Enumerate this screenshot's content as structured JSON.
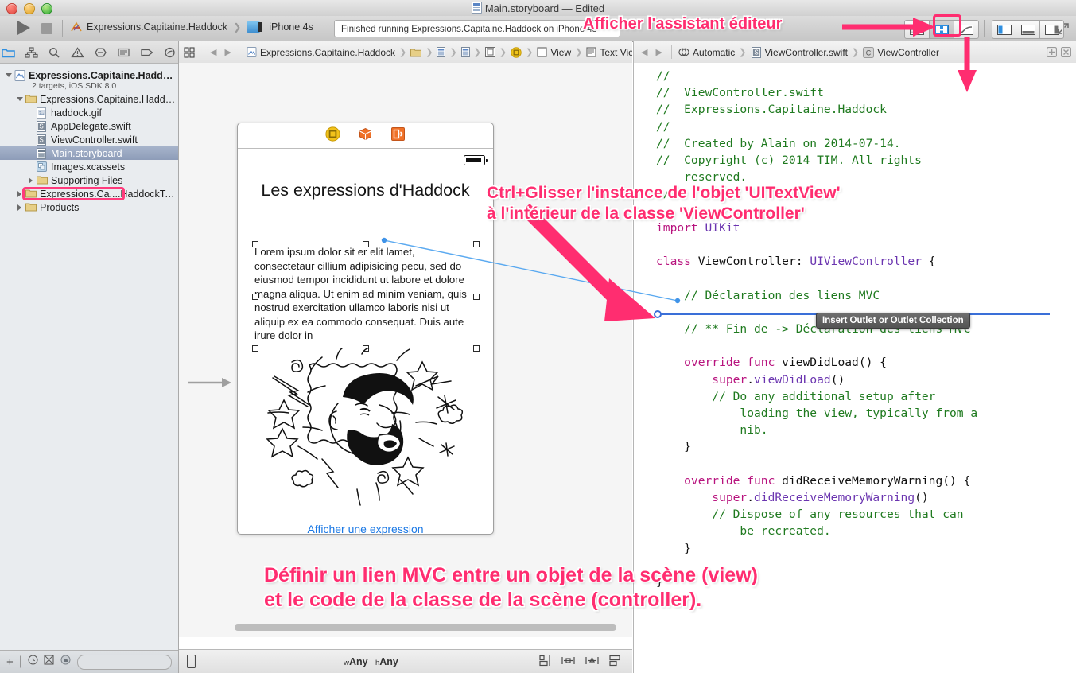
{
  "window": {
    "title": "Main.storyboard — Edited",
    "doc_icon": "storyboard-icon"
  },
  "toolbar": {
    "run_icon": "run-play-icon",
    "stop_icon": "stop-icon",
    "scheme_name": "Expressions.Capitaine.Haddock",
    "destination": "iPhone 4s",
    "status_text": "Finished running Expressions.Capitaine.Haddock on iPhone 4s",
    "editor_buttons": [
      {
        "name": "standard-editor",
        "selected": false
      },
      {
        "name": "assistant-editor",
        "selected": true
      },
      {
        "name": "version-editor",
        "selected": false
      }
    ],
    "view_buttons": [
      {
        "name": "toggle-navigator",
        "selected": true
      },
      {
        "name": "toggle-debug-area",
        "selected": false
      },
      {
        "name": "toggle-utilities",
        "selected": false
      }
    ],
    "fullscreen_icon": "fullscreen-icon"
  },
  "navigator": {
    "tabs": [
      "folder-icon",
      "hierarchy-icon",
      "search-icon",
      "warning-icon",
      "breakpoint-icon",
      "report-icon",
      "tag-icon",
      "test-icon"
    ],
    "selected_tab": "folder-icon",
    "project": {
      "name": "Expressions.Capitaine.Haddock",
      "subtitle": "2 targets, iOS SDK 8.0"
    },
    "items": [
      {
        "label": "Expressions.Capitaine.Haddock",
        "icon": "folder-icon",
        "depth": 1,
        "twisty": "open"
      },
      {
        "label": "haddock.gif",
        "icon": "image-file-icon",
        "depth": 2,
        "twisty": "none"
      },
      {
        "label": "AppDelegate.swift",
        "icon": "swift-file-icon",
        "depth": 2,
        "twisty": "none"
      },
      {
        "label": "ViewController.swift",
        "icon": "swift-file-icon",
        "depth": 2,
        "twisty": "none"
      },
      {
        "label": "Main.storyboard",
        "icon": "storyboard-file-icon",
        "depth": 2,
        "twisty": "none",
        "selected": true
      },
      {
        "label": "Images.xcassets",
        "icon": "assets-icon",
        "depth": 2,
        "twisty": "none"
      },
      {
        "label": "Supporting Files",
        "icon": "folder-icon",
        "depth": 2,
        "twisty": "closed"
      },
      {
        "label": "Expressions.Ca....HaddockTests",
        "icon": "folder-icon",
        "depth": 1,
        "twisty": "closed"
      },
      {
        "label": "Products",
        "icon": "folder-icon",
        "depth": 1,
        "twisty": "closed"
      }
    ],
    "footer": {
      "add_label": "+",
      "filter_placeholder": ""
    }
  },
  "left_editor": {
    "jumpbar": {
      "grid_icon": "related-items-icon",
      "back_icon": "back-arrow-icon",
      "forward_icon": "forward-arrow-icon",
      "path": [
        {
          "label": "Expressions.Capitaine.Haddock",
          "icon": "project-icon"
        },
        {
          "label": "",
          "icon": "folder-icon"
        },
        {
          "label": "",
          "icon": "storyboard-file-icon"
        },
        {
          "label": "",
          "icon": "scene-icon"
        },
        {
          "label": "",
          "icon": "viewcontroller-icon"
        },
        {
          "label": "",
          "icon": "yellow-circle-icon"
        },
        {
          "label": "View",
          "icon": "view-icon"
        },
        {
          "label": "Text View",
          "icon": "textview-icon"
        }
      ]
    },
    "scene": {
      "bar_icons": [
        "first-responder-icon",
        "exit-icon",
        "exit-segue-icon"
      ],
      "battery_icon": "battery-icon",
      "title": "Les expressions d'Haddock",
      "textview_body": "Lorem ipsum dolor sit er elit lamet, consectetaur cillium adipisicing pecu, sed do eiusmod tempor incididunt ut labore et dolore magna aliqua. Ut enim ad minim veniam, quis nostrud exercitation ullamco laboris nisi ut aliquip ex ea commodo consequat. Duis aute irure dolor in",
      "image_name": "haddock-shouting-cartoon",
      "button_label": "Afficher une expression"
    },
    "size_bar": {
      "device_icon": "device-icon",
      "width_prefix": "w",
      "width_value": "Any",
      "height_prefix": "h",
      "height_value": "Any",
      "right_icons": [
        "align-icon",
        "pin-icon",
        "resolve-icon",
        "resize-icon"
      ]
    }
  },
  "right_editor": {
    "jumpbar": {
      "back_icon": "back-arrow-icon",
      "forward_icon": "forward-arrow-icon",
      "path": [
        {
          "label": "Automatic",
          "icon": "automatic-icon"
        },
        {
          "label": "ViewController.swift",
          "icon": "swift-file-icon"
        },
        {
          "label": "ViewController",
          "icon": "class-icon"
        }
      ],
      "add_icon": "add-assistant-icon",
      "close_icon": "close-assistant-icon"
    },
    "code_lines": [
      [
        {
          "t": "//",
          "c": "cmt"
        }
      ],
      [
        {
          "t": "//  ViewController.swift",
          "c": "cmt"
        }
      ],
      [
        {
          "t": "//  Expressions.Capitaine.Haddock",
          "c": "cmt"
        }
      ],
      [
        {
          "t": "//",
          "c": "cmt"
        }
      ],
      [
        {
          "t": "//  Created by Alain on 2014-07-14.",
          "c": "cmt"
        }
      ],
      [
        {
          "t": "//  Copyright (c) 2014 TIM. All rights",
          "c": "cmt"
        }
      ],
      [
        {
          "t": "    reserved.",
          "c": "cmt"
        }
      ],
      [
        {
          "t": "//",
          "c": "cmt"
        }
      ],
      [
        {
          "t": "",
          "c": "plain"
        }
      ],
      [
        {
          "t": "import ",
          "c": "kw"
        },
        {
          "t": "UIKit",
          "c": "type"
        }
      ],
      [
        {
          "t": "",
          "c": "plain"
        }
      ],
      [
        {
          "t": "class ",
          "c": "kw"
        },
        {
          "t": "ViewController",
          "c": "plain"
        },
        {
          "t": ": ",
          "c": "plain"
        },
        {
          "t": "UIViewController",
          "c": "type"
        },
        {
          "t": " {",
          "c": "plain"
        }
      ],
      [
        {
          "t": "",
          "c": "plain"
        }
      ],
      [
        {
          "t": "    // Déclaration des liens MVC",
          "c": "cmt"
        }
      ],
      [
        {
          "t": "",
          "c": "plain"
        }
      ],
      [
        {
          "t": "    // ** Fin de -> Déclaration des liens MVC",
          "c": "cmt"
        }
      ],
      [
        {
          "t": "",
          "c": "plain"
        }
      ],
      [
        {
          "t": "    override func ",
          "c": "kw"
        },
        {
          "t": "viewDidLoad",
          "c": "plain"
        },
        {
          "t": "() {",
          "c": "plain"
        }
      ],
      [
        {
          "t": "        super",
          "c": "kw"
        },
        {
          "t": ".",
          "c": "plain"
        },
        {
          "t": "viewDidLoad",
          "c": "type"
        },
        {
          "t": "()",
          "c": "plain"
        }
      ],
      [
        {
          "t": "        // Do any additional setup after",
          "c": "cmt"
        }
      ],
      [
        {
          "t": "            loading the view, typically from a",
          "c": "cmt"
        }
      ],
      [
        {
          "t": "            nib.",
          "c": "cmt"
        }
      ],
      [
        {
          "t": "    }",
          "c": "plain"
        }
      ],
      [
        {
          "t": "",
          "c": "plain"
        }
      ],
      [
        {
          "t": "    override func ",
          "c": "kw"
        },
        {
          "t": "didReceiveMemoryWarning",
          "c": "plain"
        },
        {
          "t": "() {",
          "c": "plain"
        }
      ],
      [
        {
          "t": "        super",
          "c": "kw"
        },
        {
          "t": ".",
          "c": "plain"
        },
        {
          "t": "didReceiveMemoryWarning",
          "c": "type"
        },
        {
          "t": "()",
          "c": "plain"
        }
      ],
      [
        {
          "t": "        // Dispose of any resources that can",
          "c": "cmt"
        }
      ],
      [
        {
          "t": "            be recreated.",
          "c": "cmt"
        }
      ],
      [
        {
          "t": "    }",
          "c": "plain"
        }
      ],
      [
        {
          "t": "",
          "c": "plain"
        }
      ],
      [
        {
          "t": "}",
          "c": "plain"
        }
      ]
    ],
    "tooltip": "Insert Outlet or Outlet Collection"
  },
  "annotations": {
    "assistant": "Afficher l'assistant éditeur",
    "ctrl_drag_line1": "Ctrl+Glisser l'instance de l'objet 'UITextView'",
    "ctrl_drag_line2": "à l'intérieur de la classe 'ViewController'",
    "bottom_line1": "Définir un lien MVC entre un objet de la scène (view)",
    "bottom_line2": "et le code de la classe de la scène (controller)."
  },
  "colors": {
    "annotation_pink": "#ff2d70",
    "selection_blue": "#8d9cb8",
    "link_blue": "#1a78e5",
    "comment_green": "#1f7a1f",
    "keyword_magenta": "#b8137e",
    "type_purple": "#6b35b0"
  }
}
